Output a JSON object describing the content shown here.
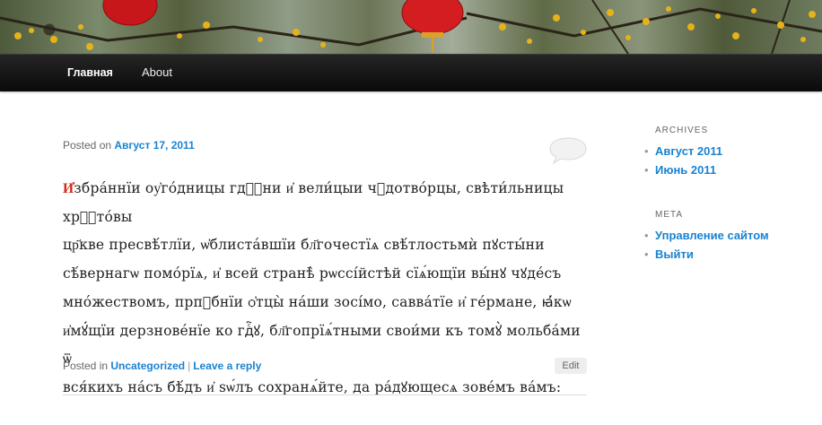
{
  "nav": {
    "home_label": "Главная",
    "about_label": "About"
  },
  "post": {
    "posted_on_prefix": "Posted on",
    "date": "Август 17, 2011",
    "initial": "И҆",
    "body_lines": [
      "збра́ннїи оу҆го́дницы гдⷭ҇ни и҆ вели́цыи чꙋдотво́рцы, свѣти́льницы хрⷭ҇то́вы",
      "цр҃кве пресвѣ́тлїи, ѡ҆блиста́вшїи бл҃гочестїѧ свѣ́тлостьмѝ пꙋсты́ни",
      "сѣ́вернагѡ помо́рїѧ, и҆ всей странѣ̀ рѡссі́йстѣй сїѧ́ющїи вы́нꙋ чꙋде́съ",
      "мно́жествомъ, прпⷣбнїи ѻ҆тцы̀ на́ши зосі́мо, савва́тїе и҆ ге́рмане, ꙗ҆́кѡ",
      "и҆мꙋ́щїи дерзнове́нїе ко гдⷭ҇ꙋ, бл҃гопрїѧ́тными свои́ми къ томꙋ̀ мольба́ми ѿ",
      "вся́кихъ на́съ бѣ́дъ и҆ ѕѡ́лъ сохранѧ́йте, да ра́дꙋющесѧ зове́мъ ва́мъ:"
    ],
    "posted_in_prefix": "Posted in",
    "category": "Uncategorized",
    "separator": "|",
    "leave_reply": "Leave a reply",
    "edit_label": "Edit"
  },
  "sidebar": {
    "archives_title": "ARCHIVES",
    "archives": [
      {
        "label": "Август 2011"
      },
      {
        "label": "Июнь 2011"
      }
    ],
    "meta_title": "META",
    "meta": [
      {
        "label": "Управление сайтом"
      },
      {
        "label": "Выйти"
      }
    ],
    "bullet": "•"
  },
  "colors": {
    "link": "#1982d1",
    "initial": "#d22a1a",
    "nav_bg": "#151515"
  }
}
